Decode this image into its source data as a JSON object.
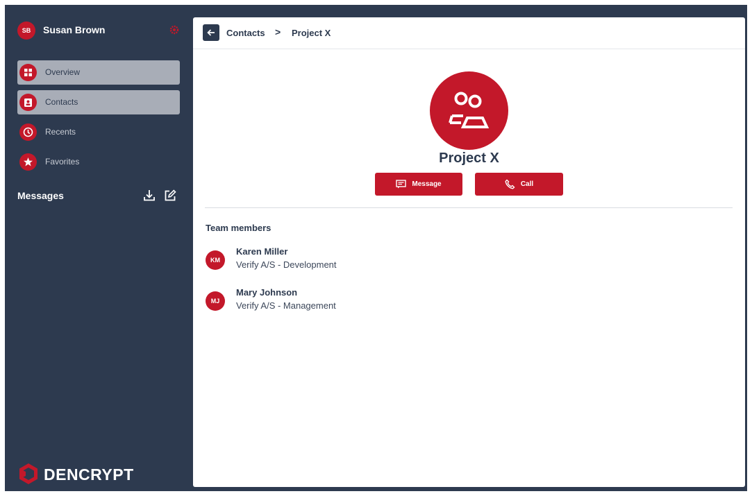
{
  "colors": {
    "sidebar_bg": "#2d3a4f",
    "accent": "#c3182a",
    "active_nav_bg": "#a8adb7",
    "panel_bg": "#ffffff"
  },
  "user": {
    "initials": "SB",
    "name": "Susan Brown",
    "settings_icon": "gear-icon"
  },
  "nav": {
    "items": [
      {
        "label": "Overview",
        "icon": "grid-icon",
        "active": true
      },
      {
        "label": "Contacts",
        "icon": "contact-card-icon",
        "active": true
      },
      {
        "label": "Recents",
        "icon": "clock-icon",
        "active": false
      },
      {
        "label": "Favorites",
        "icon": "star-icon",
        "active": false
      }
    ]
  },
  "messages": {
    "title": "Messages",
    "actions": [
      "download-icon",
      "compose-icon"
    ]
  },
  "brand": {
    "logo_text": "DENCRYPT"
  },
  "breadcrumb": {
    "items": [
      "Contacts",
      "Project X"
    ],
    "separator": ">"
  },
  "group": {
    "name": "Project X",
    "icon": "group-icon",
    "actions": {
      "message_label": "Message",
      "call_label": "Call"
    }
  },
  "team": {
    "title": "Team members",
    "members": [
      {
        "initials": "KM",
        "name": "Karen Miller",
        "org": "Verify A/S - Development"
      },
      {
        "initials": "MJ",
        "name": "Mary Johnson",
        "org": "Verify A/S - Management"
      }
    ]
  }
}
